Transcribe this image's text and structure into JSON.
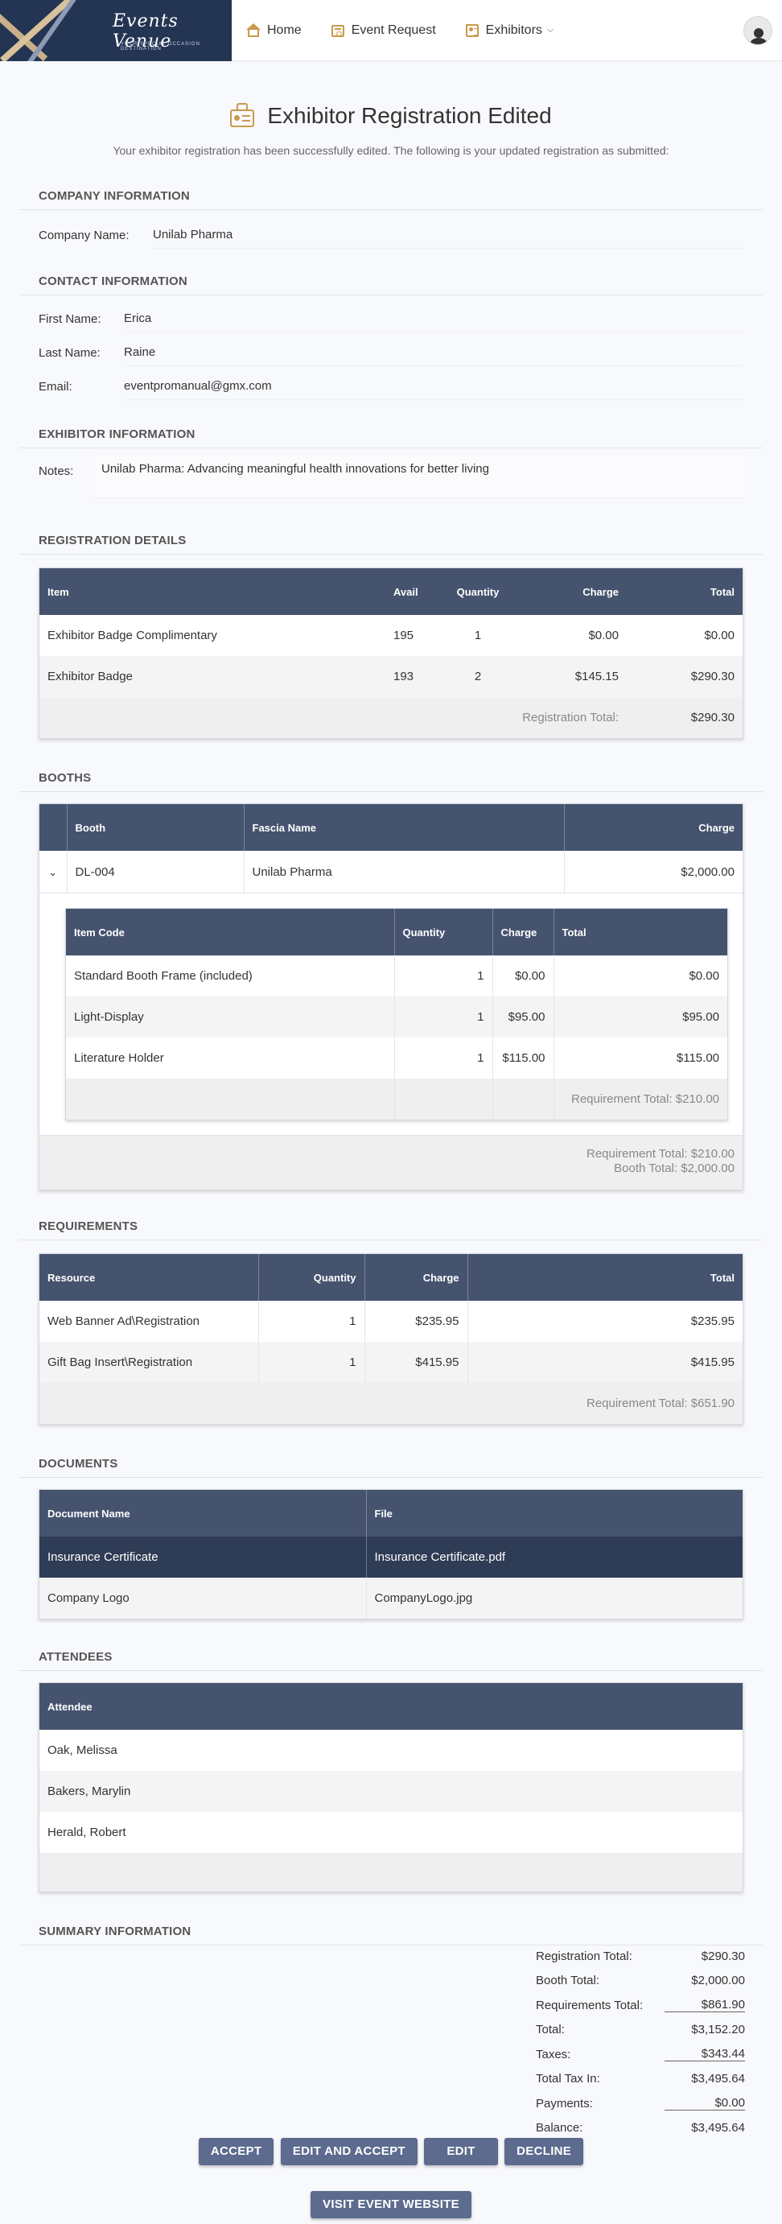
{
  "nav": {
    "logo_text": "Events Venue",
    "logo_tagline": "YOUR SPECIAL OCCASION DESTINATION",
    "items": [
      {
        "label": "Home",
        "icon": "home-icon"
      },
      {
        "label": "Event Request",
        "icon": "calendar-icon"
      },
      {
        "label": "Exhibitors",
        "icon": "exhibitor-icon"
      }
    ]
  },
  "page": {
    "title": "Exhibitor Registration Edited",
    "subtitle": "Your exhibitor registration has been successfully edited. The following is your updated registration as submitted:"
  },
  "company": {
    "heading": "COMPANY INFORMATION",
    "name_label": "Company Name:",
    "name_value": "Unilab Pharma"
  },
  "contact": {
    "heading": "CONTACT INFORMATION",
    "first_label": "First Name:",
    "first_value": "Erica",
    "last_label": "Last Name:",
    "last_value": "Raine",
    "email_label": "Email:",
    "email_value": "eventpromanual@gmx.com"
  },
  "exhibitor": {
    "heading": "EXHIBITOR INFORMATION",
    "notes_label": "Notes:",
    "notes_value": "Unilab Pharma: Advancing meaningful health innovations for better living"
  },
  "registration": {
    "heading": "REGISTRATION DETAILS",
    "columns": [
      "Item",
      "Avail",
      "Quantity",
      "Charge",
      "Total"
    ],
    "rows": [
      {
        "item": "Exhibitor Badge Complimentary",
        "avail": "195",
        "qty": "1",
        "charge": "$0.00",
        "total": "$0.00"
      },
      {
        "item": "Exhibitor Badge",
        "avail": "193",
        "qty": "2",
        "charge": "$145.15",
        "total": "$290.30"
      }
    ],
    "total_label": "Registration Total:",
    "total_value": "$290.30"
  },
  "booths": {
    "heading": "BOOTHS",
    "columns": [
      "Booth",
      "Fascia Name",
      "Charge"
    ],
    "booth": {
      "code": "DL-004",
      "fascia": "Unilab Pharma",
      "charge": "$2,000.00"
    },
    "sub_columns": [
      "Item Code",
      "Quantity",
      "Charge",
      "Total"
    ],
    "sub_rows": [
      {
        "code": "Standard Booth Frame (included)",
        "qty": "1",
        "charge": "$0.00",
        "total": "$0.00"
      },
      {
        "code": "Light-Display",
        "qty": "1",
        "charge": "$95.00",
        "total": "$95.00"
      },
      {
        "code": "Literature Holder",
        "qty": "1",
        "charge": "$115.00",
        "total": "$115.00"
      }
    ],
    "sub_total": "Requirement Total: $210.00",
    "foot_req": "Requirement Total: $210.00",
    "foot_booth": "Booth Total: $2,000.00"
  },
  "requirements": {
    "heading": "REQUIREMENTS",
    "columns": [
      "Resource",
      "Quantity",
      "Charge",
      "Total"
    ],
    "rows": [
      {
        "resource": "Web Banner Ad\\Registration",
        "qty": "1",
        "charge": "$235.95",
        "total": "$235.95"
      },
      {
        "resource": "Gift Bag Insert\\Registration",
        "qty": "1",
        "charge": "$415.95",
        "total": "$415.95"
      }
    ],
    "total": "Requirement Total: $651.90"
  },
  "documents": {
    "heading": "DOCUMENTS",
    "columns": [
      "Document Name",
      "File"
    ],
    "rows": [
      {
        "name": "Insurance Certificate",
        "file": "Insurance Certificate.pdf"
      },
      {
        "name": "Company Logo",
        "file": "CompanyLogo.jpg"
      }
    ]
  },
  "attendees": {
    "heading": "ATTENDEES",
    "column": "Attendee",
    "rows": [
      "Oak, Melissa",
      "Bakers, Marylin",
      "Herald, Robert"
    ]
  },
  "summary": {
    "heading": "SUMMARY INFORMATION",
    "rows": [
      {
        "label": "Registration Total:",
        "value": "$290.30"
      },
      {
        "label": "Booth Total:",
        "value": "$2,000.00"
      },
      {
        "label": "Requirements Total:",
        "value": "$861.90"
      },
      {
        "label": "Total:",
        "value": "$3,152.20"
      },
      {
        "label": "Taxes:",
        "value": "$343.44"
      },
      {
        "label": "Total Tax In:",
        "value": "$3,495.64"
      },
      {
        "label": "Payments:",
        "value": "$0.00"
      },
      {
        "label": "Balance:",
        "value": "$3,495.64"
      }
    ]
  },
  "actions": {
    "accept": "ACCEPT",
    "edit_accept": "EDIT AND ACCEPT",
    "edit": "EDIT",
    "decline": "DECLINE",
    "visit": "VISIT EVENT WEBSITE"
  }
}
